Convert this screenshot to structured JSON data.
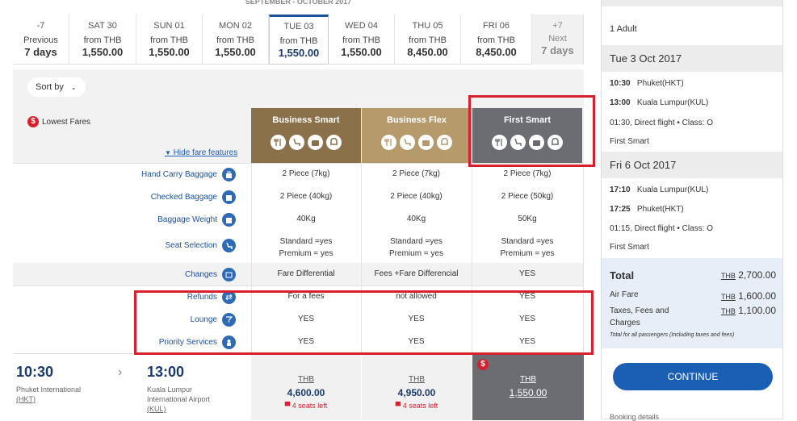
{
  "month_header": "SEPTEMBER - OCTOBER 2017",
  "dates": [
    {
      "label": "-7",
      "from": "Previous",
      "price": "7 days"
    },
    {
      "label": "SAT 30",
      "from": "from THB",
      "price": "1,550.00"
    },
    {
      "label": "SUN 01",
      "from": "from THB",
      "price": "1,550.00"
    },
    {
      "label": "MON 02",
      "from": "from THB",
      "price": "1,550.00"
    },
    {
      "label": "TUE 03",
      "from": "from THB",
      "price": "1,550.00"
    },
    {
      "label": "WED 04",
      "from": "from THB",
      "price": "1,550.00"
    },
    {
      "label": "THU 05",
      "from": "from THB",
      "price": "8,450.00"
    },
    {
      "label": "FRI 06",
      "from": "from THB",
      "price": "8,450.00"
    },
    {
      "label": "+7",
      "from": "Next",
      "price": "7 days"
    }
  ],
  "sort_by": "Sort by",
  "lowest_fares": "Lowest Fares",
  "hide_features": "Hide fare features",
  "fares": [
    {
      "name": "Business Smart",
      "color": "#8b7149"
    },
    {
      "name": "Business Flex",
      "color": "#b69a6c"
    },
    {
      "name": "First Smart",
      "color": "#6b6d73"
    }
  ],
  "features": [
    {
      "label": "Hand Carry Baggage",
      "values": [
        "2 Piece (7kg)",
        "2 Piece (7kg)",
        "2 Piece (7kg)"
      ]
    },
    {
      "label": "Checked Baggage",
      "values": [
        "2 Piece (40kg)",
        "2 Piece (40kg)",
        "2 Piece (50kg)"
      ]
    },
    {
      "label": "Baggage Weight",
      "values": [
        "40Kg",
        "40Kg",
        "50Kg"
      ]
    },
    {
      "label": "Seat Selection",
      "values": [
        "Standard =yes",
        "Standard =yes",
        "Standard =yes"
      ],
      "values2": [
        "Premium = yes",
        "Premium = yes",
        "Premium = yes"
      ]
    },
    {
      "label": "Changes",
      "values": [
        "Fare Differential",
        "Fees +Fare Differencial",
        "YES"
      ]
    },
    {
      "label": "Refunds",
      "values": [
        "For a fees",
        "not allowed",
        "YES"
      ]
    },
    {
      "label": "Lounge",
      "values": [
        "YES",
        "YES",
        "YES"
      ]
    },
    {
      "label": "Priority Services",
      "values": [
        "YES",
        "YES",
        "YES"
      ]
    }
  ],
  "flight": {
    "depart_time": "10:30",
    "depart_airport_1": "Phuket International",
    "depart_airport_2": "(HKT)",
    "arrive_time": "13:00",
    "arrive_airport_1": "Kuala Lumpur",
    "arrive_airport_2": "International Airport",
    "arrive_airport_3": "(KUL)",
    "prices": [
      {
        "cur": "THB",
        "value": "4,600.00",
        "seats": "4 seats left"
      },
      {
        "cur": "THB",
        "value": "4,950.00",
        "seats": "4 seats left"
      },
      {
        "cur": "THB",
        "value": "1,550.00",
        "seats": ""
      }
    ]
  },
  "sidebar": {
    "passengers": "1 Adult",
    "leg1_date": "Tue 3 Oct 2017",
    "leg1_dep_time": "10:30",
    "leg1_dep": "Phuket(HKT)",
    "leg1_arr_time": "13:00",
    "leg1_arr": "Kuala Lumpur(KUL)",
    "leg1_info": "01:30, Direct flight",
    "leg1_class": "Class: O",
    "leg1_fare": "First Smart",
    "leg2_date": "Fri 6 Oct 2017",
    "leg2_dep_time": "17:10",
    "leg2_dep": "Kuala Lumpur(KUL)",
    "leg2_arr_time": "17:25",
    "leg2_arr": "Phuket(HKT)",
    "leg2_info": "01:15, Direct flight",
    "leg2_class": "Class: O",
    "leg2_fare": "First Smart",
    "total_label": "Total",
    "total_cur": "THB",
    "total_value": "2,700.00",
    "airfare_label": "Air Fare",
    "airfare_cur": "THB",
    "airfare_value": "1,600.00",
    "taxes_label_1": "Taxes, Fees and",
    "taxes_label_2": "Charges",
    "taxes_cur": "THB",
    "taxes_value": "1,100.00",
    "total_note": "Total for all passengers (Including taxes and fees)",
    "continue": "CONTINUE",
    "booking_details": "Booking details"
  }
}
